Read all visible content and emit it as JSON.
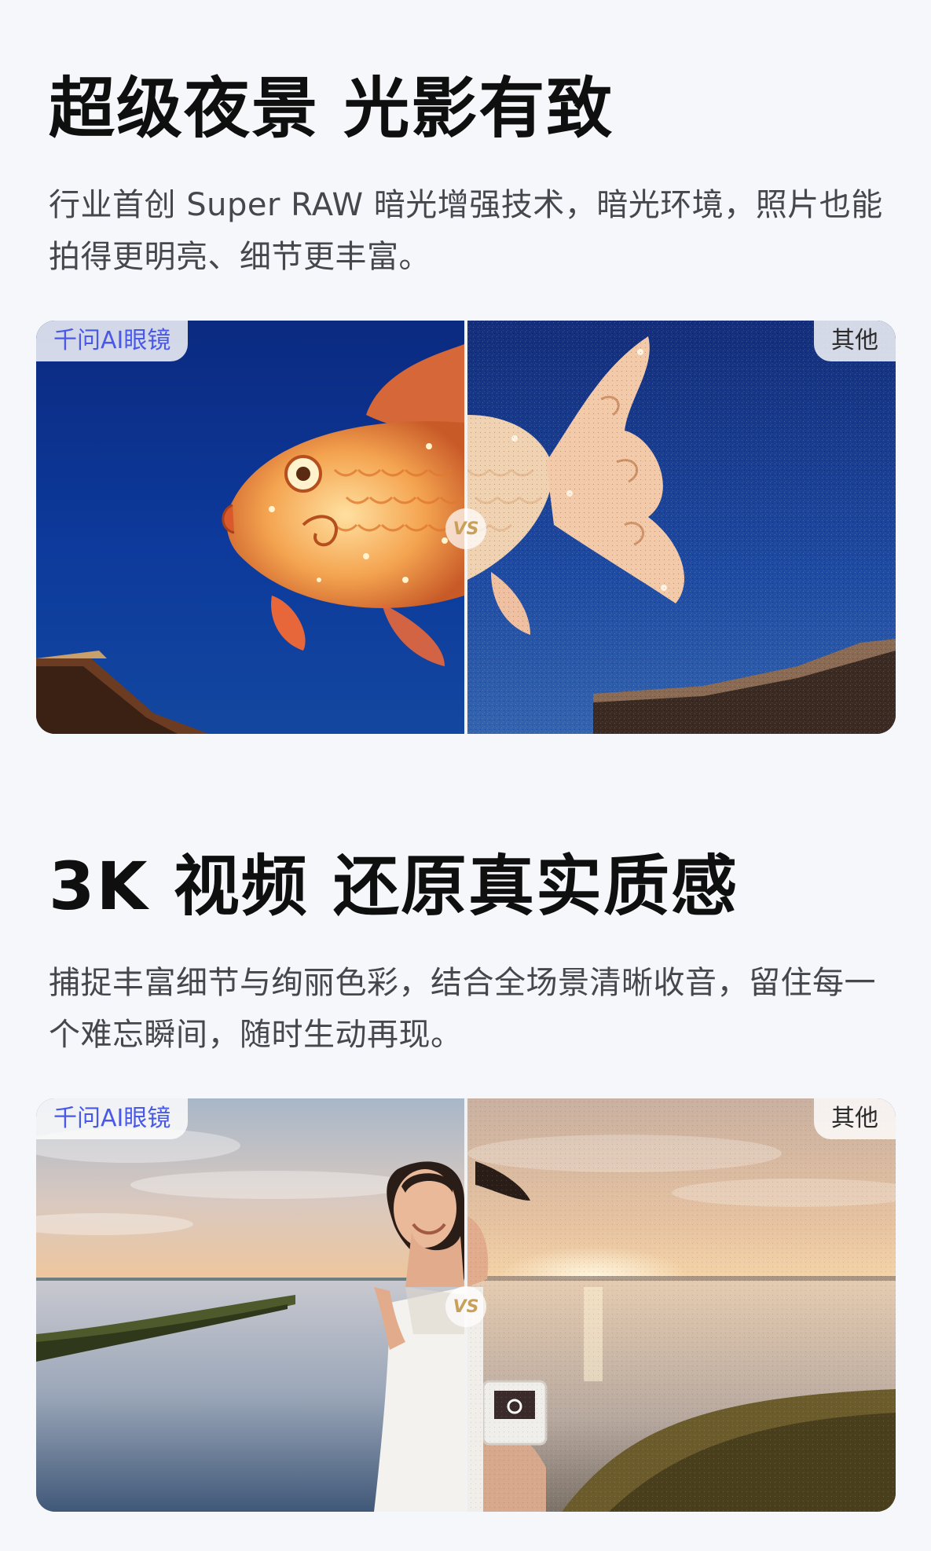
{
  "section_night": {
    "title": "超级夜景 光影有致",
    "description": "行业首创 Super RAW 暗光增强技术，暗光环境，照片也能拍得更明亮、细节更丰富。",
    "compare": {
      "left_tag": "千问AI眼镜",
      "right_tag": "其他",
      "vs_label": "VS"
    }
  },
  "section_video": {
    "title": "3K 视频 还原真实质感",
    "description": "捕捉丰富细节与绚丽色彩，结合全场景清晰收音，留住每一个难忘瞬间，随时生动再现。",
    "compare": {
      "left_tag": "千问AI眼镜",
      "right_tag": "其他",
      "vs_label": "VS"
    }
  },
  "colors": {
    "page_background": "#f6f7fb",
    "brand_tag_text": "#4a58e8",
    "vs_badge_text": "#c9a05a",
    "divider": "#f2f2f2"
  },
  "icons": {
    "vs_badge": "vs-badge-icon"
  }
}
